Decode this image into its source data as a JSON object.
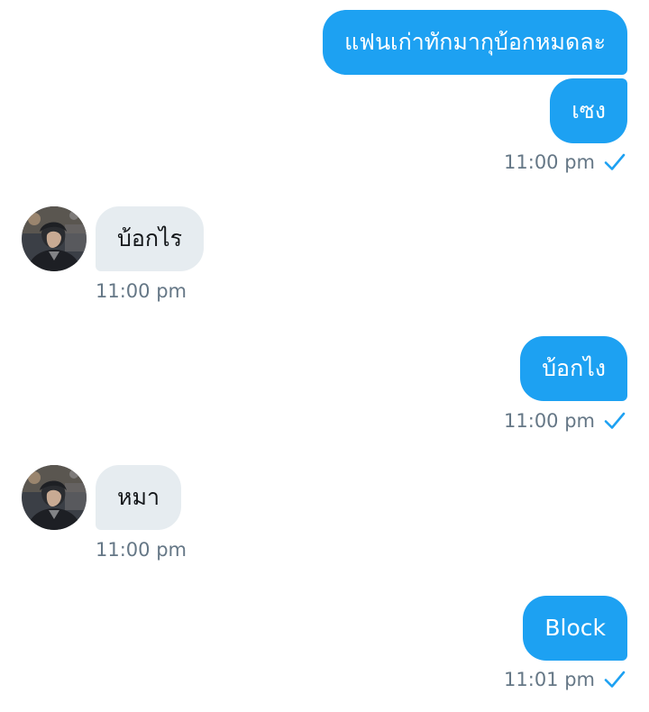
{
  "colors": {
    "outgoing_bubble": "#1da1f2",
    "incoming_bubble": "#e6ecf0",
    "timestamp": "#657786",
    "read_check": "#1da1f2"
  },
  "messages": [
    {
      "direction": "outgoing",
      "text": "แฟนเก่าทักมากุบ้อกหมดละ"
    },
    {
      "direction": "outgoing",
      "text": "เซง",
      "time": "11:00 pm",
      "status_icon": "check-icon"
    },
    {
      "direction": "incoming",
      "text": "บ้อกไร",
      "time": "11:00 pm",
      "avatar_icon": "avatar"
    },
    {
      "direction": "outgoing",
      "text": "บ้อกไง",
      "time": "11:00 pm",
      "status_icon": "check-icon"
    },
    {
      "direction": "incoming",
      "text": "หมา",
      "time": "11:00 pm",
      "avatar_icon": "avatar"
    },
    {
      "direction": "outgoing",
      "text": "Block",
      "time": "11:01 pm",
      "status_icon": "check-icon"
    }
  ]
}
